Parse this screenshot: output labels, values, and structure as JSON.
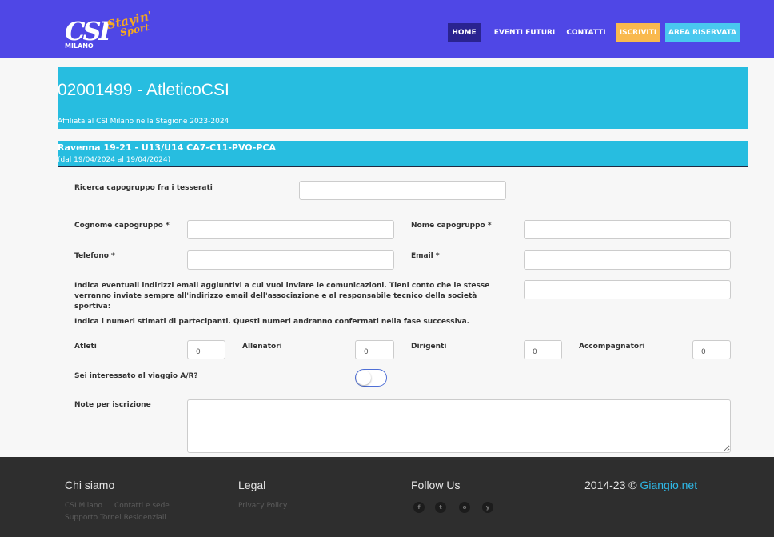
{
  "header": {
    "logo_city": "MILANO",
    "brand_line1": "Stayin'",
    "brand_line2": "Sport",
    "nav": {
      "home": "HOME",
      "eventi": "EVENTI FUTURI",
      "contatti": "CONTATTI",
      "iscriviti": "ISCRIVITI",
      "area": "AREA RISERVATA"
    }
  },
  "page": {
    "title": "02001499 - AtleticoCSI",
    "affiliation": "Affiliata al CSI Milano nella Stagione 2023-2024",
    "event_name": "Ravenna 19-21 - U13/U14 CA7-C11-PVO-PCA",
    "event_dates": "(dal 19/04/2024 al 19/04/2024)"
  },
  "form": {
    "search_label": "Ricerca capogruppo fra i tesserati",
    "search_value": "",
    "cognome_label": "Cognome capogruppo *",
    "cognome_value": "",
    "nome_label": "Nome capogruppo *",
    "nome_value": "",
    "telefono_label": "Telefono *",
    "telefono_value": "",
    "email_label": "Email *",
    "email_value": "",
    "extra_email_line1": "Indica eventuali indirizzi email aggiuntivi a cui vuoi inviare le comunicazioni. Tieni conto che le stesse",
    "extra_email_line2": "verranno inviate sempre all'indirizzo email dell'associazione e al responsabile tecnico della società sportiva:",
    "extra_email_value": "",
    "partecipanti_note": "Indica i numeri stimati di partecipanti. Questi numeri andranno confermati nella fase successiva.",
    "atleti_label": "Atleti",
    "atleti_value": "0",
    "allenatori_label": "Allenatori",
    "allenatori_value": "0",
    "dirigenti_label": "Dirigenti",
    "dirigenti_value": "0",
    "accompagnatori_label": "Accompagnatori",
    "accompagnatori_value": "0",
    "viaggio_label": "Sei interessato al viaggio A/R?",
    "viaggio_on": false,
    "note_label": "Note per iscrizione",
    "note_value": ""
  },
  "footer": {
    "chi_siamo": "Chi siamo",
    "link_csi": "CSI Milano",
    "link_contatti": "Contatti e sede",
    "link_supporto": "Supporto Tornei Residenziali",
    "legal": "Legal",
    "privacy": "Privacy Policy",
    "follow": "Follow Us",
    "social": {
      "facebook": "f",
      "twitter": "t",
      "instagram": "o",
      "youtube": "y"
    },
    "copyright": "2014-23 ©",
    "copyright_link": "Giangio.net"
  },
  "colors": {
    "header_bg": "#4f47e6",
    "band_bg": "#27bde0",
    "iscriviti_bg": "#f9b94e",
    "area_bg": "#49c8ef",
    "footer_bg": "#2e2e2e",
    "link_accent": "#2eb9e8"
  }
}
